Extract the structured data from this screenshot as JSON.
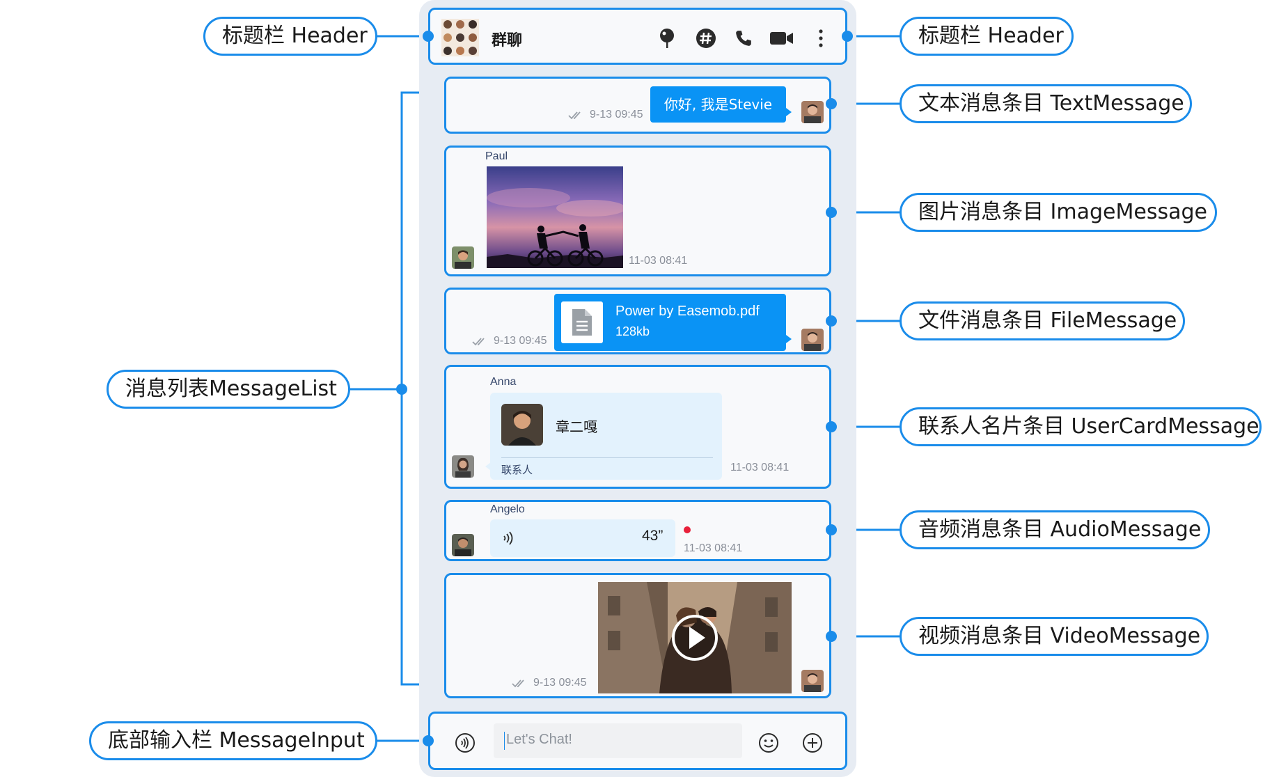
{
  "header": {
    "title": "群聊",
    "icons": [
      "pin-icon",
      "hashtag-icon",
      "phone-icon",
      "video-camera-icon",
      "more-vertical-icon"
    ]
  },
  "messages": {
    "text": {
      "content": "你好, 我是Stevie",
      "time": "9-13 09:45"
    },
    "image": {
      "sender": "Paul",
      "time": "11-03 08:41"
    },
    "file": {
      "name": "Power by Easemob.pdf",
      "size": "128kb",
      "time": "9-13 09:45"
    },
    "card": {
      "sender": "Anna",
      "name": "章二嘎",
      "footer": "联系人",
      "time": "11-03 08:41"
    },
    "audio": {
      "sender": "Angelo",
      "duration": "43”",
      "time": "11-03 08:41"
    },
    "video": {
      "time": "9-13 09:45"
    }
  },
  "input": {
    "placeholder": "Let's Chat!"
  },
  "callouts": {
    "header_left": "标题栏 Header",
    "header_right": "标题栏 Header",
    "text_message": "文本消息条目 TextMessage",
    "image_message": "图片消息条目 ImageMessage",
    "file_message": "文件消息条目 FileMessage",
    "usercard_message": "联系人名片条目 UserCardMessage",
    "audio_message": "音频消息条目 AudioMessage",
    "video_message": "视频消息条目 VideoMessage",
    "message_list": "消息列表MessageList",
    "message_input": "底部输入栏  MessageInput"
  },
  "colors": {
    "accent": "#1a8cea",
    "bubble": "#0a93f5",
    "card_bg": "#e3f2fd",
    "unread_dot": "#e8203a"
  }
}
